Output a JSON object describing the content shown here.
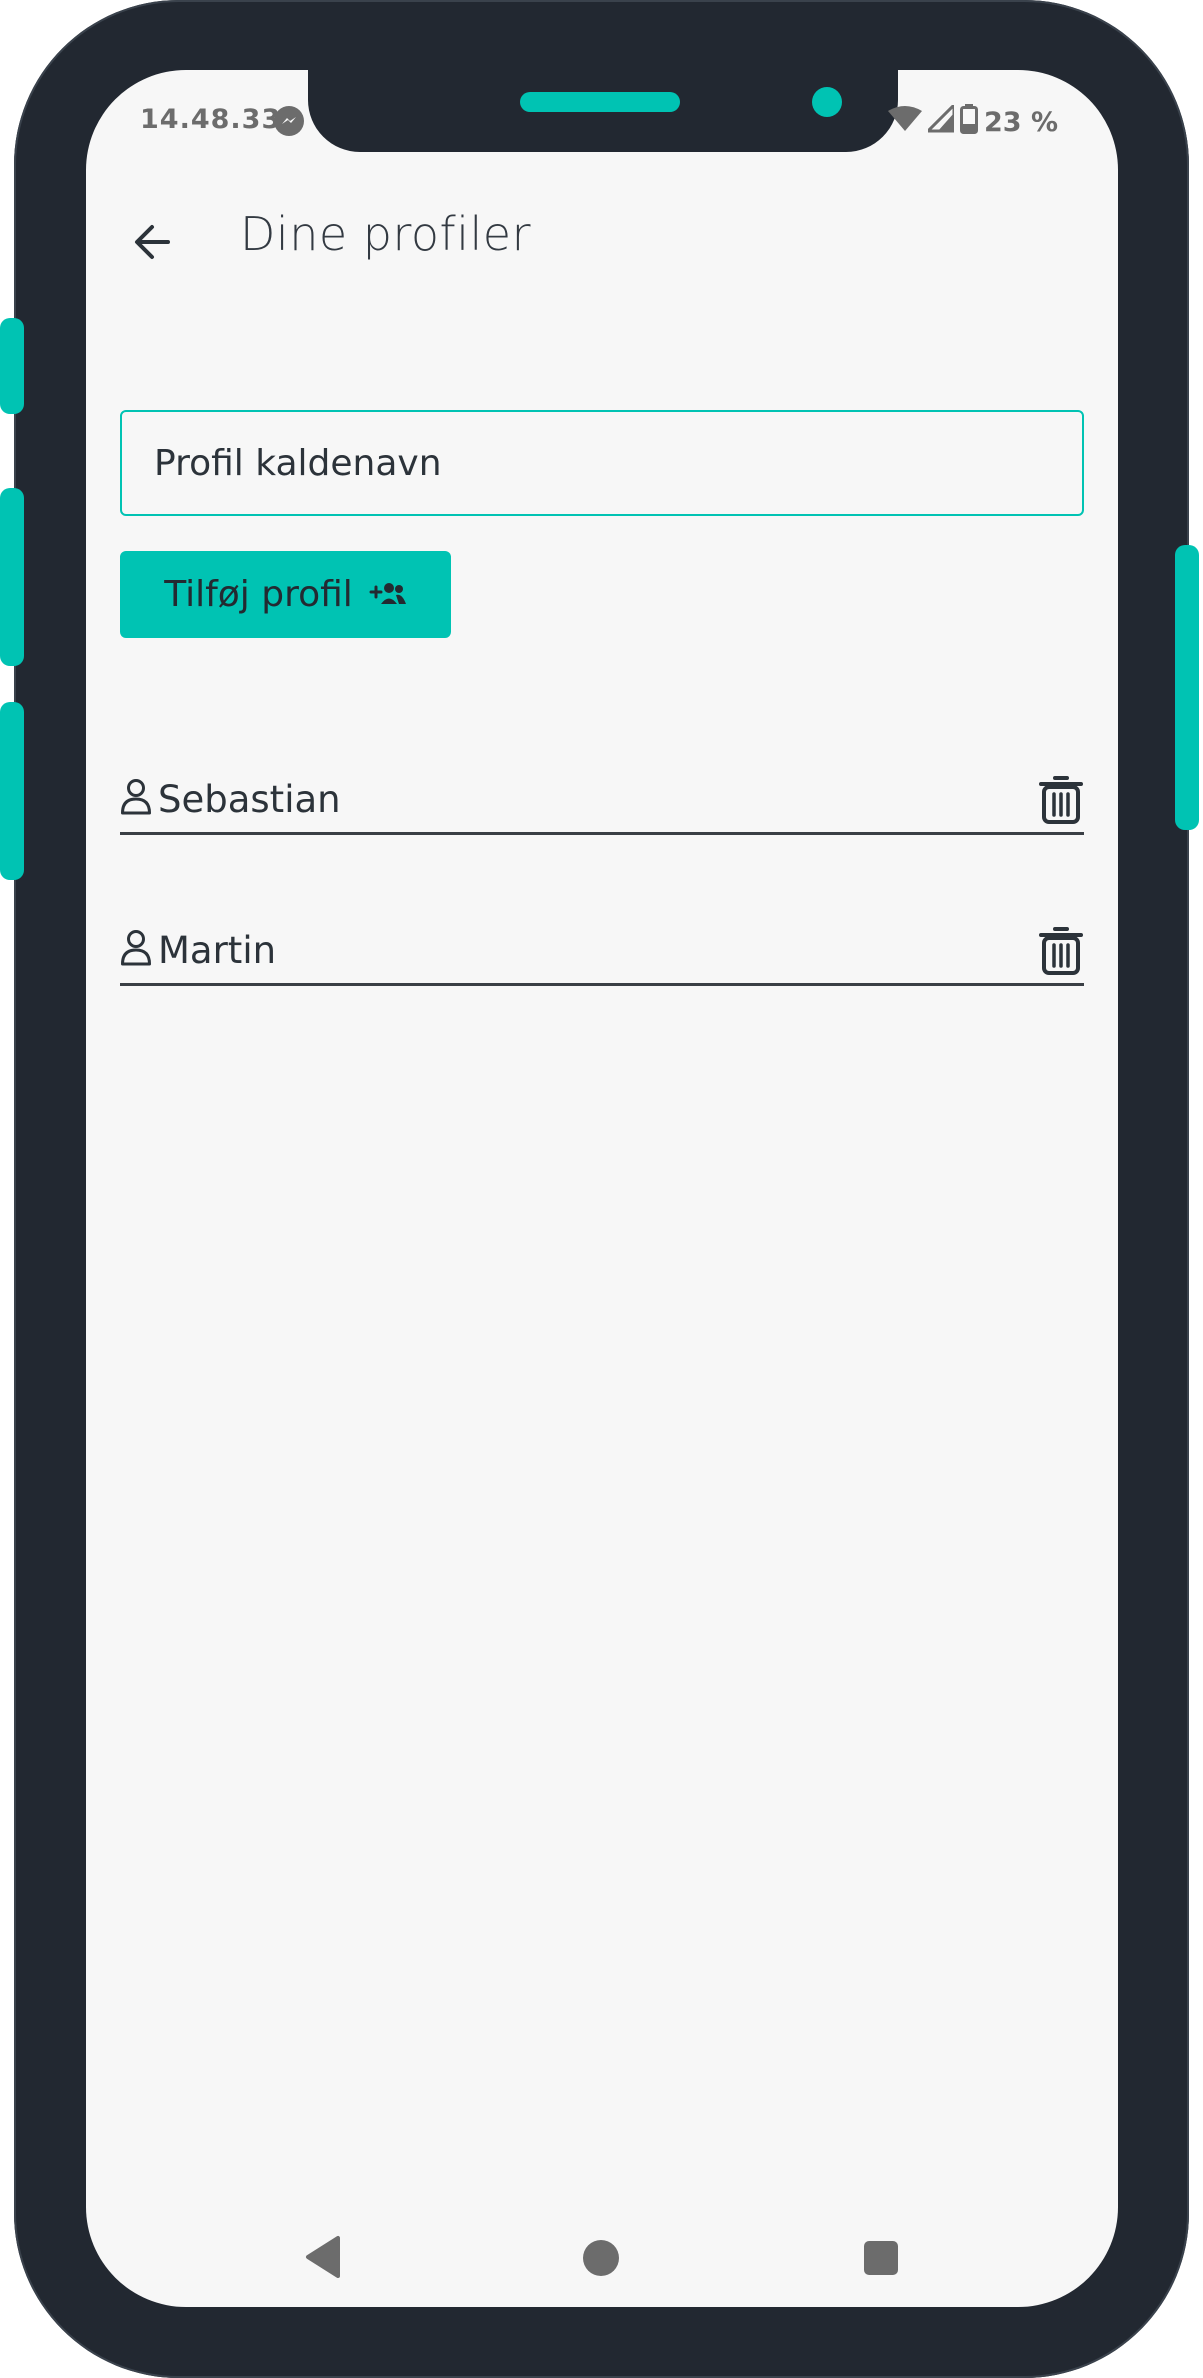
{
  "status_bar": {
    "time": "14.48.33",
    "battery": "23 %"
  },
  "app_bar": {
    "title": "Dine profiler"
  },
  "form": {
    "nickname_placeholder": "Profil kaldenavn",
    "nickname_value": "",
    "add_button_label": "Tilføj profil"
  },
  "profiles": [
    {
      "name": "Sebastian"
    },
    {
      "name": "Martin"
    }
  ],
  "icons": {
    "back": "arrow-back-icon",
    "add_profile": "group-add-icon",
    "profile": "person-outline-icon",
    "delete": "trash-icon",
    "messenger": "messenger-icon",
    "wifi": "wifi-icon",
    "signal": "signal-icon",
    "battery": "battery-icon"
  },
  "colors": {
    "accent": "#00c3b3",
    "frame": "#222831",
    "screen_background": "#f7f7f7",
    "text": "#2c333a"
  }
}
